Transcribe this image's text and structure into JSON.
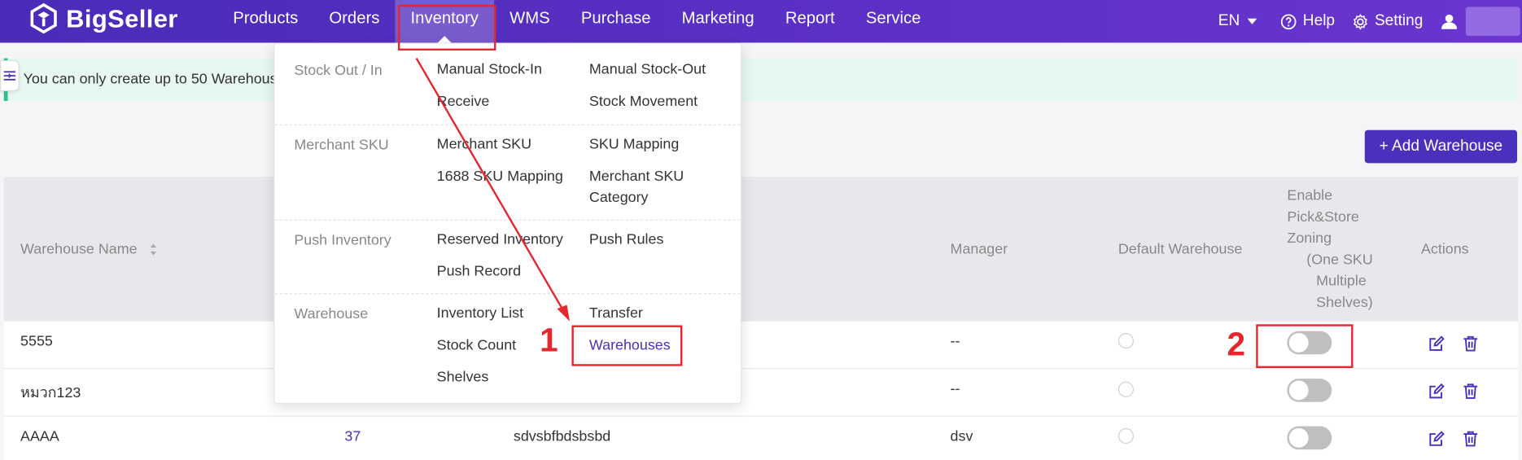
{
  "app": {
    "brand": "BigSeller"
  },
  "nav": {
    "items": [
      {
        "label": "Products"
      },
      {
        "label": "Orders"
      },
      {
        "label": "Inventory"
      },
      {
        "label": "WMS"
      },
      {
        "label": "Purchase"
      },
      {
        "label": "Marketing"
      },
      {
        "label": "Report"
      },
      {
        "label": "Service"
      }
    ],
    "lang": "EN",
    "help": "Help",
    "setting": "Setting"
  },
  "notice": {
    "text": "You can only create up to 50 Warehouses"
  },
  "actions": {
    "add_warehouse": "+ Add Warehouse"
  },
  "dropdown": {
    "sections": [
      {
        "category": "Stock Out / In",
        "items": [
          "Manual Stock-In",
          "Manual Stock-Out",
          "Receive",
          "Stock Movement"
        ]
      },
      {
        "category": "Merchant SKU",
        "items": [
          "Merchant SKU",
          "SKU Mapping",
          "1688 SKU Mapping",
          "Merchant SKU Category"
        ]
      },
      {
        "category": "Push Inventory",
        "items": [
          "Reserved Inventory",
          "Push Rules",
          "Push Record"
        ]
      },
      {
        "category": "Warehouse",
        "items": [
          "Inventory List",
          "Transfer",
          "Stock Count",
          "Warehouses",
          "Shelves"
        ]
      }
    ]
  },
  "table": {
    "headers": {
      "name": "Warehouse Name",
      "manager": "Manager",
      "default": "Default Warehouse",
      "zoning": [
        "Enable",
        "Pick&Store",
        "Zoning",
        "(One SKU",
        "Multiple",
        "Shelves)"
      ],
      "actions": "Actions"
    },
    "rows": [
      {
        "name": "5555",
        "count": "",
        "address": "",
        "manager": "--"
      },
      {
        "name": "หมวก123",
        "count": "",
        "address": "",
        "manager": "--"
      },
      {
        "name": "AAAA",
        "count": "37",
        "address": "sdvsbfbdsbsbd",
        "manager": "dsv"
      }
    ]
  },
  "annotations": {
    "step1": "1",
    "step2": "2"
  },
  "colors": {
    "brand": "#4b2fbd",
    "annotation": "#e4262f",
    "notice_bg": "#e7f7f2"
  }
}
